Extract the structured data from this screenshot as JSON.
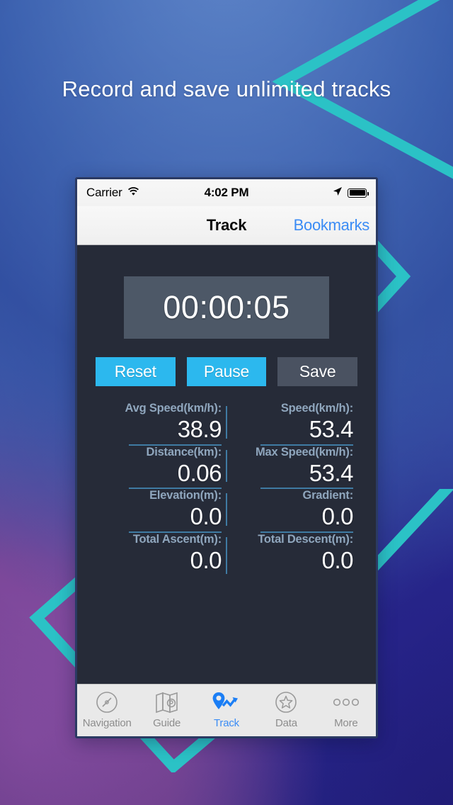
{
  "headline": "Record and save unlimited tracks",
  "theme": {
    "accent_blue": "#2cb8ee",
    "tab_active": "#3b8cf5",
    "teal_chevron": "#2bc2c6",
    "screen_bg": "#262b38",
    "timer_bg": "#4d5867",
    "label_blue": "#8fa6bd",
    "rule_blue": "#3f7ba3"
  },
  "statusbar": {
    "carrier": "Carrier",
    "wifi_icon": "wifi-icon",
    "time": "4:02 PM",
    "location_icon": "location-arrow-icon",
    "battery_icon": "battery-full-icon"
  },
  "navbar": {
    "title": "Track",
    "right_action": "Bookmarks"
  },
  "timer": {
    "value": "00:00:05"
  },
  "buttons": [
    {
      "label": "Reset",
      "name": "reset-button",
      "style": "primary"
    },
    {
      "label": "Pause",
      "name": "pause-button",
      "style": "primary"
    },
    {
      "label": "Save",
      "name": "save-button",
      "style": "muted"
    }
  ],
  "stats": [
    {
      "left": {
        "label": "Avg Speed(km/h):",
        "value": "38.9",
        "name": "avg-speed"
      },
      "right": {
        "label": "Speed(km/h):",
        "value": "53.4",
        "name": "speed"
      }
    },
    {
      "left": {
        "label": "Distance(km):",
        "value": "0.06",
        "name": "distance"
      },
      "right": {
        "label": "Max Speed(km/h):",
        "value": "53.4",
        "name": "max-speed"
      }
    },
    {
      "left": {
        "label": "Elevation(m):",
        "value": "0.0",
        "name": "elevation"
      },
      "right": {
        "label": "Gradient:",
        "value": "0.0",
        "name": "gradient"
      }
    },
    {
      "left": {
        "label": "Total Ascent(m):",
        "value": "0.0",
        "name": "total-ascent"
      },
      "right": {
        "label": "Total Descent(m):",
        "value": "0.0",
        "name": "total-descent"
      }
    }
  ],
  "tabs": [
    {
      "label": "Navigation",
      "icon": "compass-icon",
      "active": false
    },
    {
      "label": "Guide",
      "icon": "map-icon",
      "active": false
    },
    {
      "label": "Track",
      "icon": "route-pin-icon",
      "active": true
    },
    {
      "label": "Data",
      "icon": "star-circle-icon",
      "active": false
    },
    {
      "label": "More",
      "icon": "ellipsis-icon",
      "active": false
    }
  ]
}
